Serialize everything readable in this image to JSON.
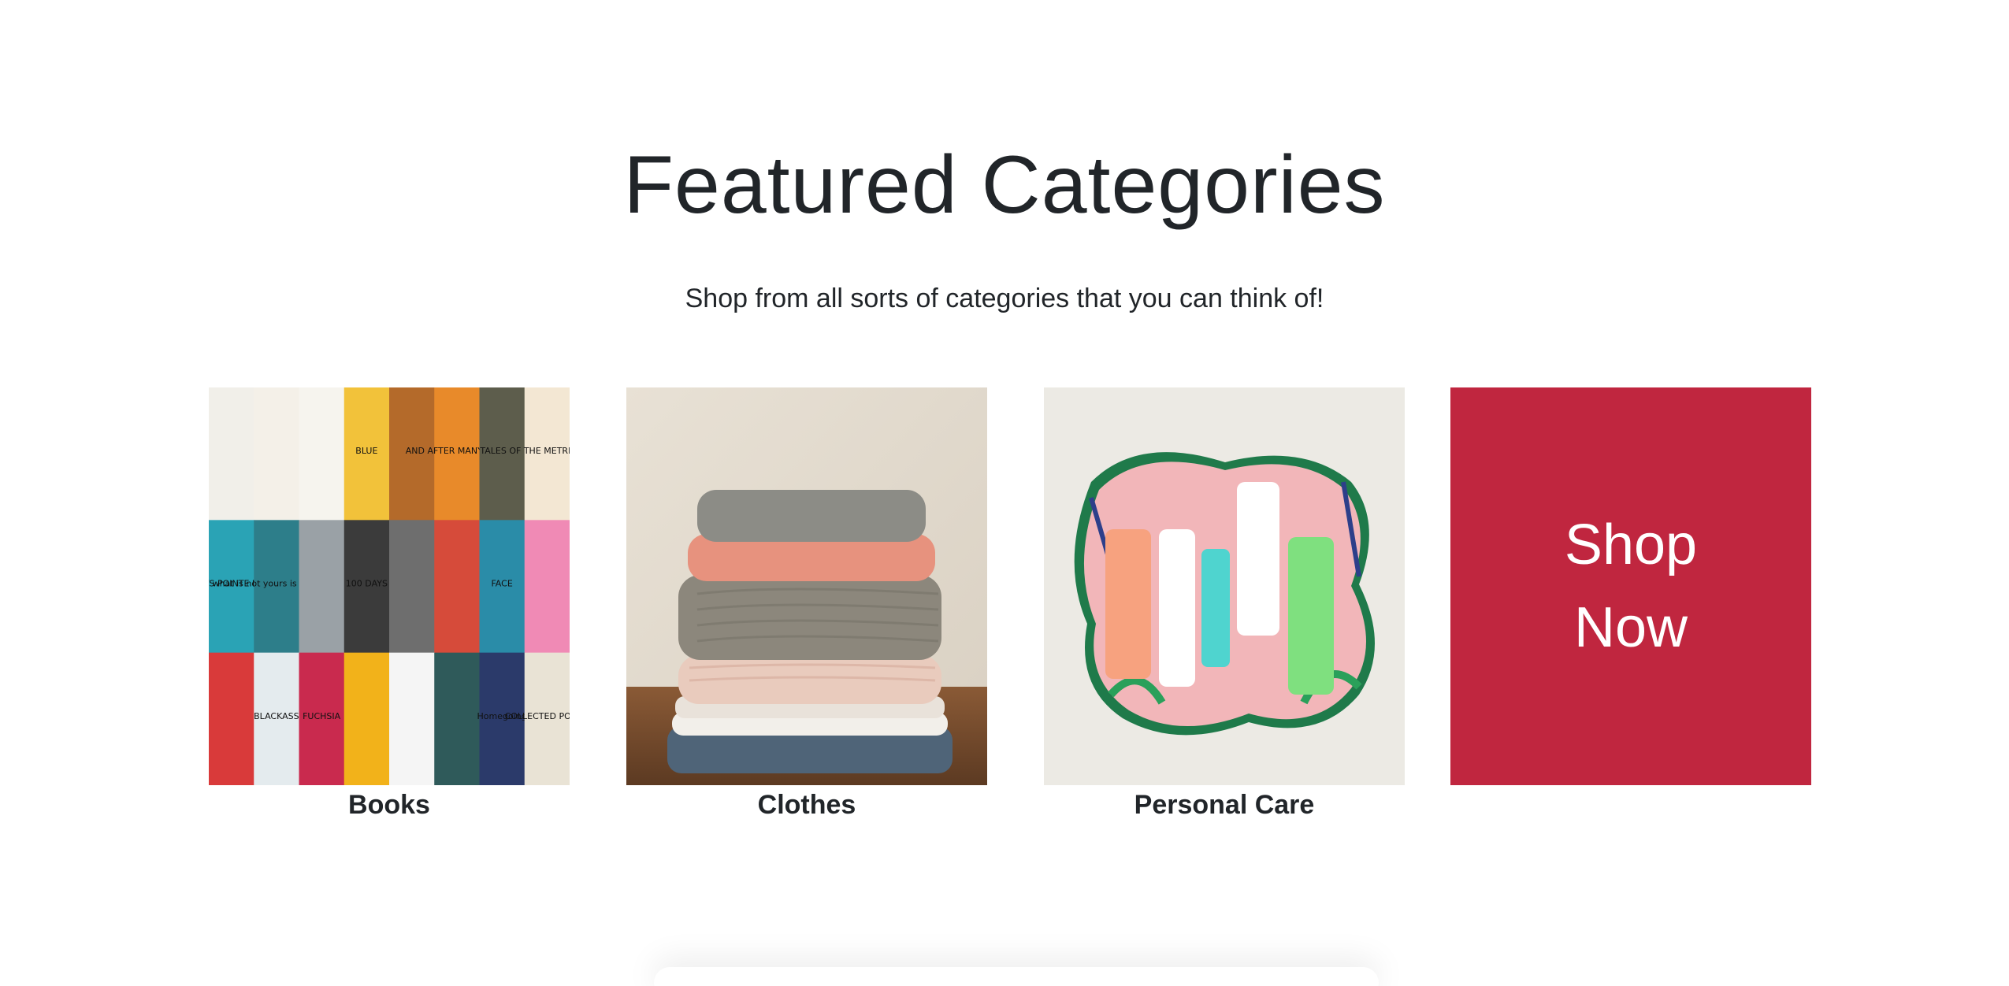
{
  "header": {
    "title": "Featured Categories",
    "subtitle": "Shop from all sorts of categories that you can think of!"
  },
  "categories": [
    {
      "label": "Books",
      "image": "book-covers-collage"
    },
    {
      "label": "Clothes",
      "image": "stacked-sweaters"
    },
    {
      "label": "Personal Care",
      "image": "skincare-tubes"
    }
  ],
  "cta": {
    "line1": "Shop",
    "line2": "Now",
    "color": "#c0263f"
  },
  "books_covers": [
    {
      "title": "",
      "color": "#f1efe9"
    },
    {
      "title": "",
      "color": "#f4f0e8"
    },
    {
      "title": "",
      "color": "#f6f4ee"
    },
    {
      "title": "BLUE",
      "color": "#f2c23a"
    },
    {
      "title": "",
      "color": "#b46a2a"
    },
    {
      "title": "AND AFTER MANY DAYS",
      "color": "#e88a2a"
    },
    {
      "title": "",
      "color": "#5d5d4c"
    },
    {
      "title": "TALES OF THE METRIC SYSTEM",
      "color": "#f3e7d3"
    },
    {
      "title": "LIGHTS POINTE NOIRE",
      "color": "#2aa3b5"
    },
    {
      "title": "what is not yours is not yours",
      "color": "#2d7e8a"
    },
    {
      "title": "",
      "color": "#9aa1a6"
    },
    {
      "title": "100 DAYS",
      "color": "#3b3b3b"
    },
    {
      "title": "",
      "color": "#6e6e6e"
    },
    {
      "title": "",
      "color": "#d64b3a"
    },
    {
      "title": "FACE",
      "color": "#2a8ca8"
    },
    {
      "title": "",
      "color": "#f08ab5"
    },
    {
      "title": "",
      "color": "#d93a3a"
    },
    {
      "title": "BLACKASS",
      "color": "#e4ebee"
    },
    {
      "title": "FUCHSIA",
      "color": "#c92a4e"
    },
    {
      "title": "",
      "color": "#f2b21a"
    },
    {
      "title": "",
      "color": "#f5f5f5"
    },
    {
      "title": "",
      "color": "#2f5a5a"
    },
    {
      "title": "Homegoing",
      "color": "#2b3a6a"
    },
    {
      "title": "COLLECTED POEMS",
      "color": "#e9e3d5"
    }
  ]
}
